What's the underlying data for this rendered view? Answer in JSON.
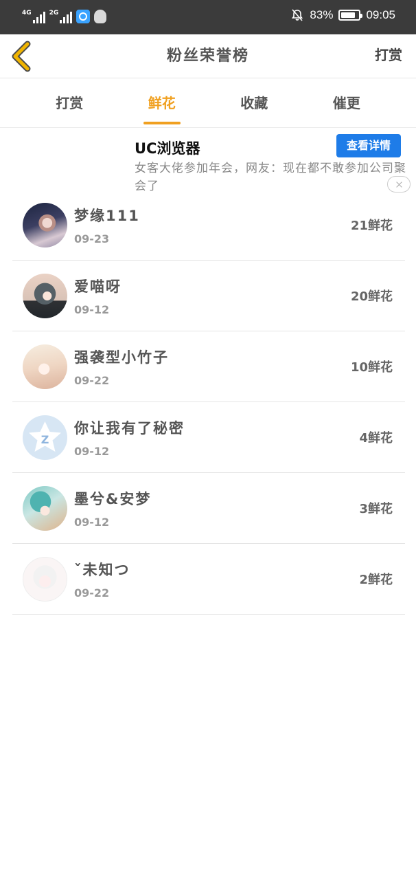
{
  "status_bar": {
    "net1_label": "4G",
    "net2_label": "2G",
    "battery_pct": "83%",
    "battery_level": 0.83,
    "time": "09:05",
    "icons": [
      "signal-icon",
      "signal-icon",
      "browser-notification-icon",
      "qq-icon",
      "mute-icon",
      "battery-icon"
    ]
  },
  "header": {
    "title": "粉丝荣誉榜",
    "action_label": "打赏",
    "back_icon": "chevron-left-icon",
    "back_color": "#f0b400"
  },
  "tabs": [
    {
      "label": "打赏",
      "active": false
    },
    {
      "label": "鲜花",
      "active": true
    },
    {
      "label": "收藏",
      "active": false
    },
    {
      "label": "催更",
      "active": false
    }
  ],
  "accent_color": "#f0a020",
  "ad": {
    "title": "UC浏览器",
    "button_label": "查看详情",
    "text": "女客大佬参加年会，网友：现在都不敢参加公司聚会了",
    "button_color": "#1e7ce8"
  },
  "fans": [
    {
      "name": "梦缘111",
      "date": "09-23",
      "count": "21鲜花"
    },
    {
      "name": "爱喵呀",
      "date": "09-12",
      "count": "20鲜花"
    },
    {
      "name": "强袭型小竹子",
      "date": "09-22",
      "count": "10鲜花"
    },
    {
      "name": "你让我有了秘密",
      "date": "09-12",
      "count": "4鲜花"
    },
    {
      "name": "墨兮&安梦",
      "date": "09-12",
      "count": "3鲜花"
    },
    {
      "name": "ˇ未知つ",
      "date": "09-22",
      "count": "2鲜花"
    }
  ]
}
